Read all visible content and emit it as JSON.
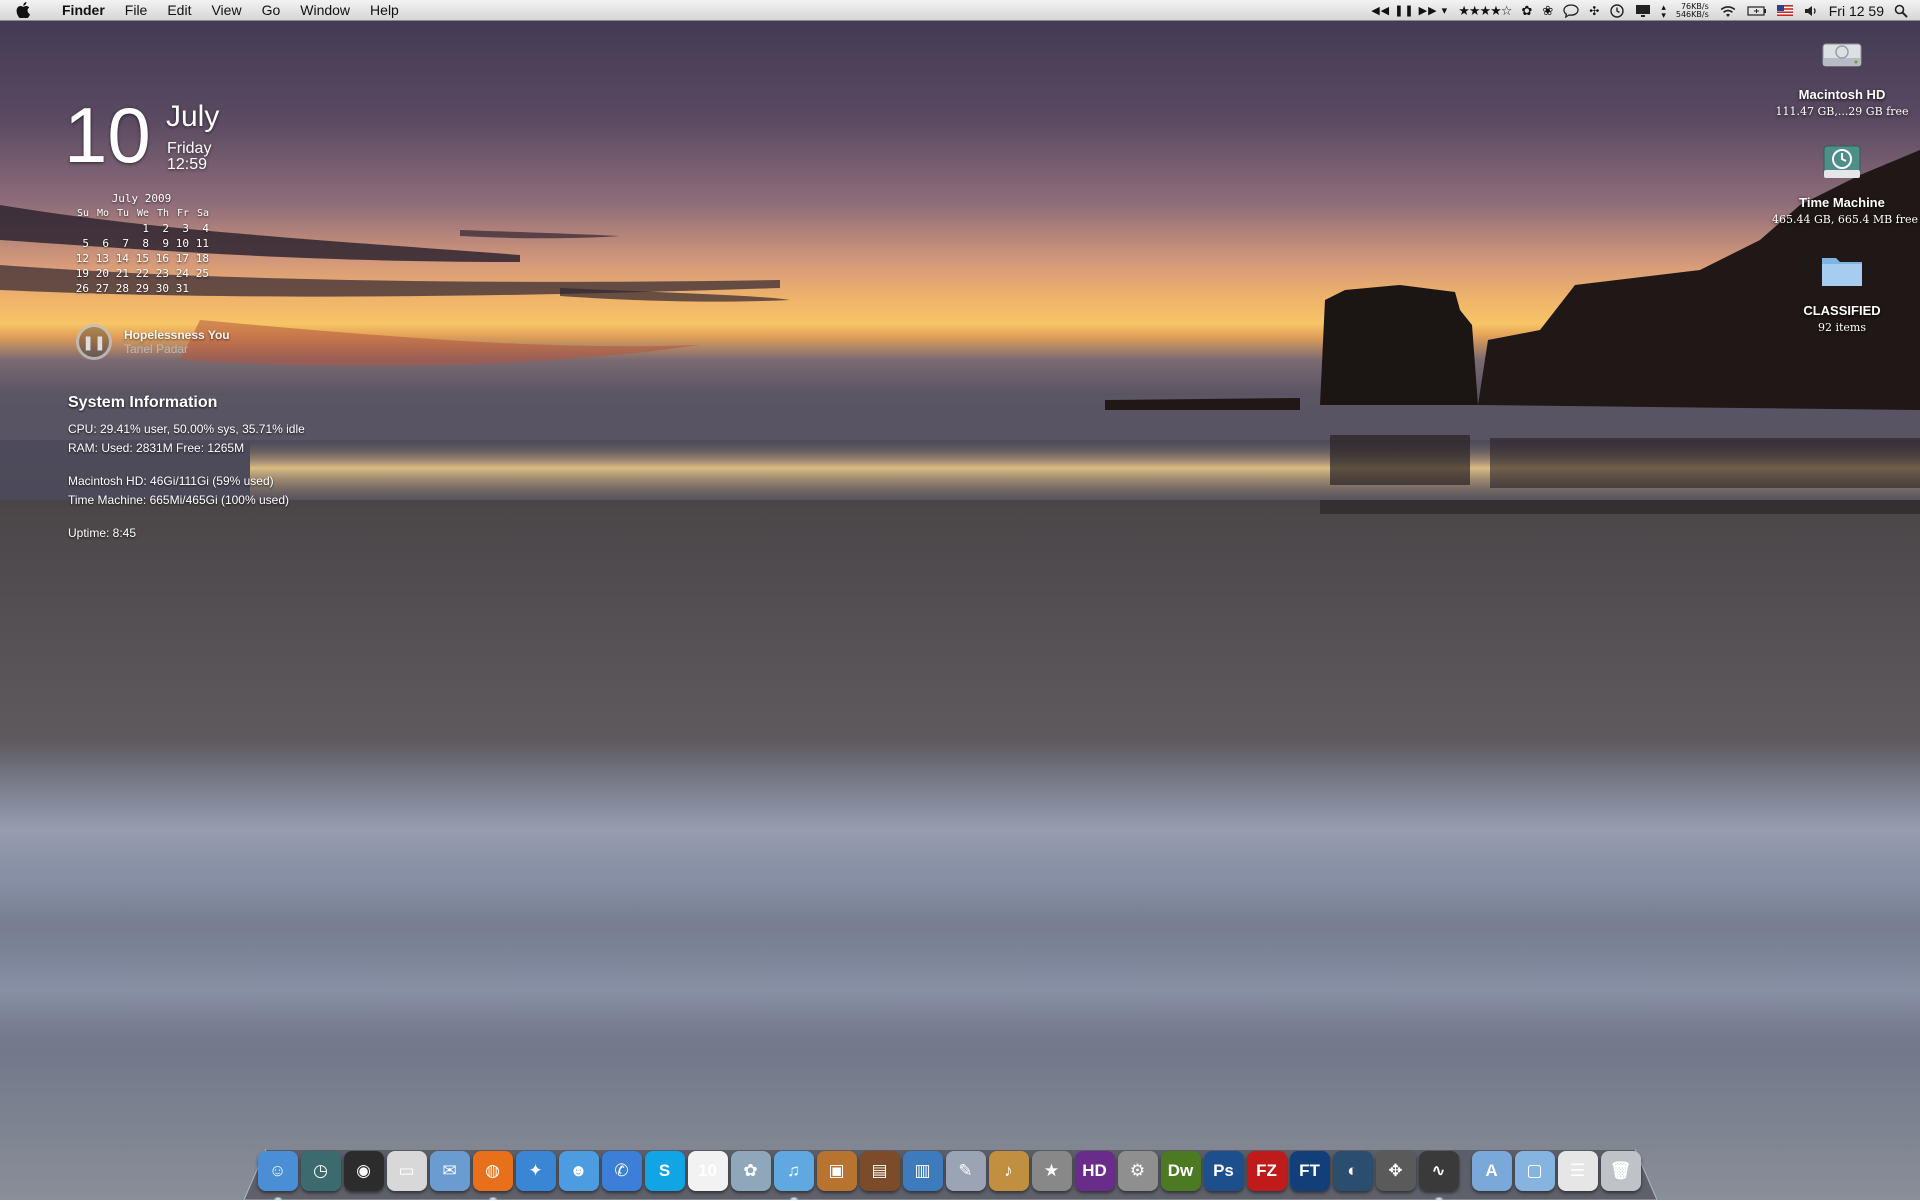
{
  "menubar": {
    "apple_icon": "apple-logo-icon",
    "items": [
      "Finder",
      "File",
      "Edit",
      "View",
      "Go",
      "Window",
      "Help"
    ],
    "netspeed_up": "76KB/s",
    "netspeed_down": "546KB/s",
    "clock": "Fri 12 59"
  },
  "date_widget": {
    "day": "10",
    "month": "July",
    "weekday": "Friday",
    "time": "12:59"
  },
  "calendar": {
    "title": "July 2009",
    "headers": [
      "Su",
      "Mo",
      "Tu",
      "We",
      "Th",
      "Fr",
      "Sa"
    ],
    "rows": [
      [
        "",
        "",
        "",
        "1",
        "2",
        "3",
        "4"
      ],
      [
        "5",
        "6",
        "7",
        "8",
        "9",
        "10",
        "11"
      ],
      [
        "12",
        "13",
        "14",
        "15",
        "16",
        "17",
        "18"
      ],
      [
        "19",
        "20",
        "21",
        "22",
        "23",
        "24",
        "25"
      ],
      [
        "26",
        "27",
        "28",
        "29",
        "30",
        "31",
        ""
      ]
    ]
  },
  "now_playing": {
    "title": "Hopelessness You",
    "artist": "Tanel Padar",
    "state": "paused"
  },
  "system_info": {
    "heading": "System Information",
    "cpu": "CPU:  29.41% user, 50.00% sys, 35.71% idle",
    "ram": "RAM:  Used: 2831M Free: 1265M",
    "disk_hd": "Macintosh HD: 46Gi/111Gi (59% used)",
    "disk_tm": "Time Machine: 665Mi/465Gi (100% used)",
    "uptime": "Uptime: 8:45"
  },
  "desktop_icons": [
    {
      "label": "Macintosh HD",
      "sub": "111.47 GB,...29 GB free",
      "icon": "hard-drive-icon"
    },
    {
      "label": "Time Machine",
      "sub": "465.44 GB, 665.4 MB free",
      "icon": "time-machine-drive-icon"
    },
    {
      "label": "CLASSIFIED",
      "sub": "92 items",
      "icon": "folder-icon"
    }
  ],
  "dock": {
    "apps": [
      {
        "name": "finder-icon",
        "color": "#4a8fd6",
        "glyph": "☺",
        "running": true
      },
      {
        "name": "time-machine-icon",
        "color": "#3b6b6f",
        "glyph": "◷",
        "running": false
      },
      {
        "name": "dashboard-icon",
        "color": "#2c2c2c",
        "glyph": "◉",
        "running": false
      },
      {
        "name": "printer-icon",
        "color": "#d8d8d8",
        "glyph": "▭",
        "running": false
      },
      {
        "name": "mail-icon",
        "color": "#6a9bd1",
        "glyph": "✉",
        "running": false
      },
      {
        "name": "firefox-icon",
        "color": "#e8701a",
        "glyph": "◍",
        "running": true
      },
      {
        "name": "safari-icon",
        "color": "#3a86d4",
        "glyph": "✦",
        "running": false
      },
      {
        "name": "ichat-buddies-icon",
        "color": "#4d9be0",
        "glyph": "☻",
        "running": false
      },
      {
        "name": "ichat-icon",
        "color": "#3b7fd8",
        "glyph": "✆",
        "running": false
      },
      {
        "name": "skype-icon",
        "color": "#12a5e6",
        "glyph": "S",
        "running": false
      },
      {
        "name": "ical-icon",
        "color": "#f2f2f2",
        "glyph": "10",
        "running": false
      },
      {
        "name": "iphoto-icon",
        "color": "#8fa7bb",
        "glyph": "✿",
        "running": false
      },
      {
        "name": "itunes-icon",
        "color": "#5fa8e0",
        "glyph": "♫",
        "running": true
      },
      {
        "name": "image-capture-icon",
        "color": "#b8742e",
        "glyph": "▣",
        "running": false
      },
      {
        "name": "keynote-icon",
        "color": "#7c4b2a",
        "glyph": "▤",
        "running": false
      },
      {
        "name": "numbers-icon",
        "color": "#3e7bbd",
        "glyph": "▥",
        "running": false
      },
      {
        "name": "script-editor-icon",
        "color": "#9aa4b4",
        "glyph": "✎",
        "running": false
      },
      {
        "name": "garageband-icon",
        "color": "#c09040",
        "glyph": "♪",
        "running": false
      },
      {
        "name": "imovie-icon",
        "color": "#888888",
        "glyph": "★",
        "running": false
      },
      {
        "name": "dvd-player-hd-icon",
        "color": "#6a2c8a",
        "glyph": "HD",
        "running": false
      },
      {
        "name": "system-preferences-icon",
        "color": "#8f8f8f",
        "glyph": "⚙",
        "running": false
      },
      {
        "name": "dreamweaver-icon",
        "color": "#4c7a23",
        "glyph": "Dw",
        "running": false
      },
      {
        "name": "photoshop-icon",
        "color": "#1d4f8c",
        "glyph": "Ps",
        "running": false
      },
      {
        "name": "filezilla-icon",
        "color": "#bf1b1b",
        "glyph": "FZ",
        "running": false
      },
      {
        "name": "full-tilt-poker-icon",
        "color": "#123f7a",
        "glyph": "FT",
        "running": false
      },
      {
        "name": "google-earth-icon",
        "color": "#2b4d6e",
        "glyph": "◐",
        "running": false
      },
      {
        "name": "move-tool-icon",
        "color": "#5a5a5a",
        "glyph": "✥",
        "running": false
      },
      {
        "name": "activity-monitor-icon",
        "color": "#3a3a3a",
        "glyph": "∿",
        "running": true
      }
    ],
    "stacks": [
      {
        "name": "applications-folder-icon",
        "color": "#7aa8d8",
        "glyph": "A"
      },
      {
        "name": "documents-folder-icon",
        "color": "#86b4e0",
        "glyph": "▢"
      },
      {
        "name": "downloads-stack-icon",
        "color": "#e6e6e6",
        "glyph": "☰"
      },
      {
        "name": "trash-icon",
        "color": "#bfc3c8",
        "glyph": "🗑"
      }
    ]
  }
}
